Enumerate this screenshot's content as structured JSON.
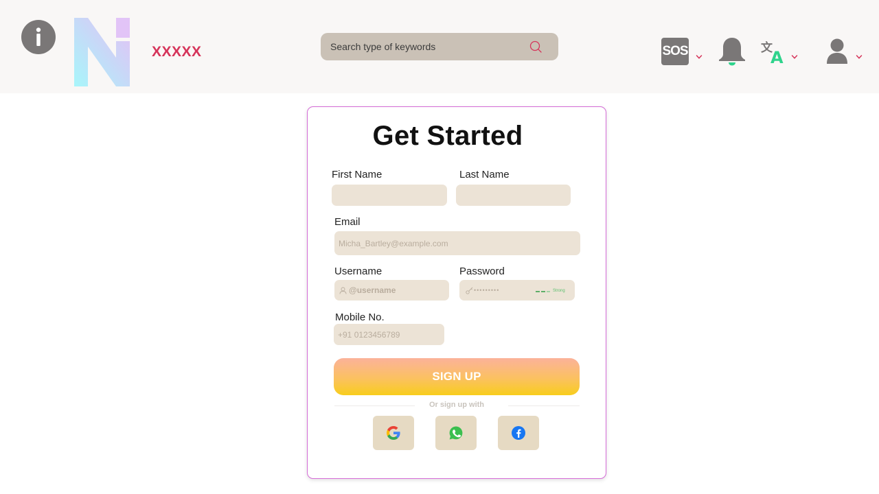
{
  "header": {
    "brand": "XXXXX",
    "search_placeholder": "Search type of keywords",
    "sos_label": "SOS"
  },
  "form": {
    "title": "Get Started",
    "first_name_label": "First Name",
    "last_name_label": "Last Name",
    "email_label": "Email",
    "email_placeholder": "Micha_Bartley@example.com",
    "username_label": "Username",
    "username_placeholder": "@username",
    "password_label": "Password",
    "password_placeholder": "•••••••••",
    "password_strength": "Strong",
    "mobile_label": "Mobile No.",
    "mobile_placeholder": "+91 0123456789",
    "signup_label": "SIGN UP",
    "or_text": "Or sign up with"
  },
  "colors": {
    "accent": "#d6345a",
    "field_bg": "#ece3d6",
    "card_border": "#d46ad6",
    "signup_gradient_top": "#fbb29a",
    "signup_gradient_bottom": "#f8cd1c",
    "social_bg": "#e6dac3"
  },
  "icons": [
    "info-icon",
    "logo-mark",
    "search-icon",
    "sos-icon",
    "bell-icon",
    "translate-icon",
    "user-icon",
    "chevron-down-icon",
    "google-icon",
    "whatsapp-icon",
    "facebook-icon"
  ]
}
